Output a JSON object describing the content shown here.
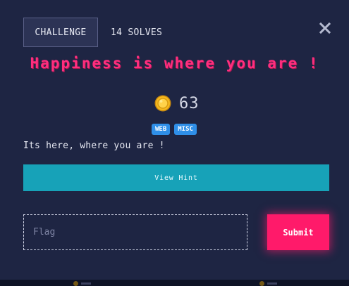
{
  "header": {
    "tab_label": "CHALLENGE",
    "solves_text": "14 SOLVES"
  },
  "challenge": {
    "title": "Happiness is where you are !",
    "points": "63",
    "tags": [
      "WEB",
      "MISC"
    ],
    "description": "Its here, where you are !"
  },
  "actions": {
    "hint_label": "View Hint",
    "flag_placeholder": "Flag",
    "flag_value": "",
    "submit_label": "Submit"
  },
  "colors": {
    "modal_bg": "#1e2543",
    "title": "#ff2e7e",
    "hint_button": "#17a2b8",
    "submit_button": "#ff1a6a",
    "tag_bg": "#2f8fe8"
  },
  "icons": {
    "close": "close-icon",
    "points": "coin-icon"
  }
}
